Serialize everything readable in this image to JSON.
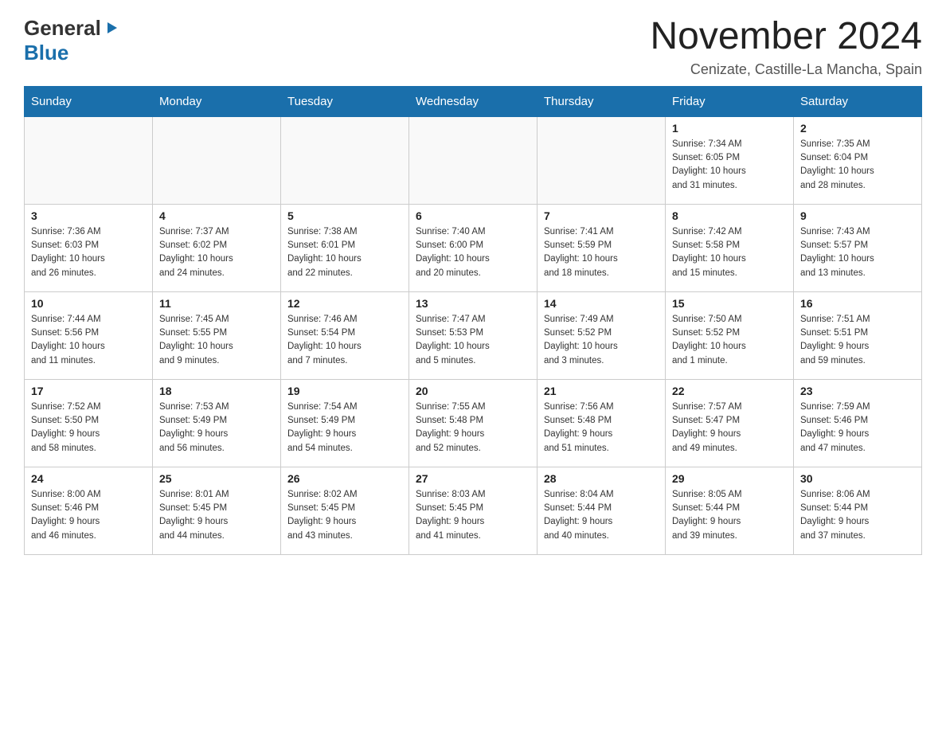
{
  "logo": {
    "general": "General",
    "blue": "Blue",
    "arrow": "▶"
  },
  "header": {
    "month_title": "November 2024",
    "location": "Cenizate, Castille-La Mancha, Spain"
  },
  "weekdays": [
    "Sunday",
    "Monday",
    "Tuesday",
    "Wednesday",
    "Thursday",
    "Friday",
    "Saturday"
  ],
  "weeks": [
    [
      {
        "day": "",
        "info": ""
      },
      {
        "day": "",
        "info": ""
      },
      {
        "day": "",
        "info": ""
      },
      {
        "day": "",
        "info": ""
      },
      {
        "day": "",
        "info": ""
      },
      {
        "day": "1",
        "info": "Sunrise: 7:34 AM\nSunset: 6:05 PM\nDaylight: 10 hours\nand 31 minutes."
      },
      {
        "day": "2",
        "info": "Sunrise: 7:35 AM\nSunset: 6:04 PM\nDaylight: 10 hours\nand 28 minutes."
      }
    ],
    [
      {
        "day": "3",
        "info": "Sunrise: 7:36 AM\nSunset: 6:03 PM\nDaylight: 10 hours\nand 26 minutes."
      },
      {
        "day": "4",
        "info": "Sunrise: 7:37 AM\nSunset: 6:02 PM\nDaylight: 10 hours\nand 24 minutes."
      },
      {
        "day": "5",
        "info": "Sunrise: 7:38 AM\nSunset: 6:01 PM\nDaylight: 10 hours\nand 22 minutes."
      },
      {
        "day": "6",
        "info": "Sunrise: 7:40 AM\nSunset: 6:00 PM\nDaylight: 10 hours\nand 20 minutes."
      },
      {
        "day": "7",
        "info": "Sunrise: 7:41 AM\nSunset: 5:59 PM\nDaylight: 10 hours\nand 18 minutes."
      },
      {
        "day": "8",
        "info": "Sunrise: 7:42 AM\nSunset: 5:58 PM\nDaylight: 10 hours\nand 15 minutes."
      },
      {
        "day": "9",
        "info": "Sunrise: 7:43 AM\nSunset: 5:57 PM\nDaylight: 10 hours\nand 13 minutes."
      }
    ],
    [
      {
        "day": "10",
        "info": "Sunrise: 7:44 AM\nSunset: 5:56 PM\nDaylight: 10 hours\nand 11 minutes."
      },
      {
        "day": "11",
        "info": "Sunrise: 7:45 AM\nSunset: 5:55 PM\nDaylight: 10 hours\nand 9 minutes."
      },
      {
        "day": "12",
        "info": "Sunrise: 7:46 AM\nSunset: 5:54 PM\nDaylight: 10 hours\nand 7 minutes."
      },
      {
        "day": "13",
        "info": "Sunrise: 7:47 AM\nSunset: 5:53 PM\nDaylight: 10 hours\nand 5 minutes."
      },
      {
        "day": "14",
        "info": "Sunrise: 7:49 AM\nSunset: 5:52 PM\nDaylight: 10 hours\nand 3 minutes."
      },
      {
        "day": "15",
        "info": "Sunrise: 7:50 AM\nSunset: 5:52 PM\nDaylight: 10 hours\nand 1 minute."
      },
      {
        "day": "16",
        "info": "Sunrise: 7:51 AM\nSunset: 5:51 PM\nDaylight: 9 hours\nand 59 minutes."
      }
    ],
    [
      {
        "day": "17",
        "info": "Sunrise: 7:52 AM\nSunset: 5:50 PM\nDaylight: 9 hours\nand 58 minutes."
      },
      {
        "day": "18",
        "info": "Sunrise: 7:53 AM\nSunset: 5:49 PM\nDaylight: 9 hours\nand 56 minutes."
      },
      {
        "day": "19",
        "info": "Sunrise: 7:54 AM\nSunset: 5:49 PM\nDaylight: 9 hours\nand 54 minutes."
      },
      {
        "day": "20",
        "info": "Sunrise: 7:55 AM\nSunset: 5:48 PM\nDaylight: 9 hours\nand 52 minutes."
      },
      {
        "day": "21",
        "info": "Sunrise: 7:56 AM\nSunset: 5:48 PM\nDaylight: 9 hours\nand 51 minutes."
      },
      {
        "day": "22",
        "info": "Sunrise: 7:57 AM\nSunset: 5:47 PM\nDaylight: 9 hours\nand 49 minutes."
      },
      {
        "day": "23",
        "info": "Sunrise: 7:59 AM\nSunset: 5:46 PM\nDaylight: 9 hours\nand 47 minutes."
      }
    ],
    [
      {
        "day": "24",
        "info": "Sunrise: 8:00 AM\nSunset: 5:46 PM\nDaylight: 9 hours\nand 46 minutes."
      },
      {
        "day": "25",
        "info": "Sunrise: 8:01 AM\nSunset: 5:45 PM\nDaylight: 9 hours\nand 44 minutes."
      },
      {
        "day": "26",
        "info": "Sunrise: 8:02 AM\nSunset: 5:45 PM\nDaylight: 9 hours\nand 43 minutes."
      },
      {
        "day": "27",
        "info": "Sunrise: 8:03 AM\nSunset: 5:45 PM\nDaylight: 9 hours\nand 41 minutes."
      },
      {
        "day": "28",
        "info": "Sunrise: 8:04 AM\nSunset: 5:44 PM\nDaylight: 9 hours\nand 40 minutes."
      },
      {
        "day": "29",
        "info": "Sunrise: 8:05 AM\nSunset: 5:44 PM\nDaylight: 9 hours\nand 39 minutes."
      },
      {
        "day": "30",
        "info": "Sunrise: 8:06 AM\nSunset: 5:44 PM\nDaylight: 9 hours\nand 37 minutes."
      }
    ]
  ]
}
